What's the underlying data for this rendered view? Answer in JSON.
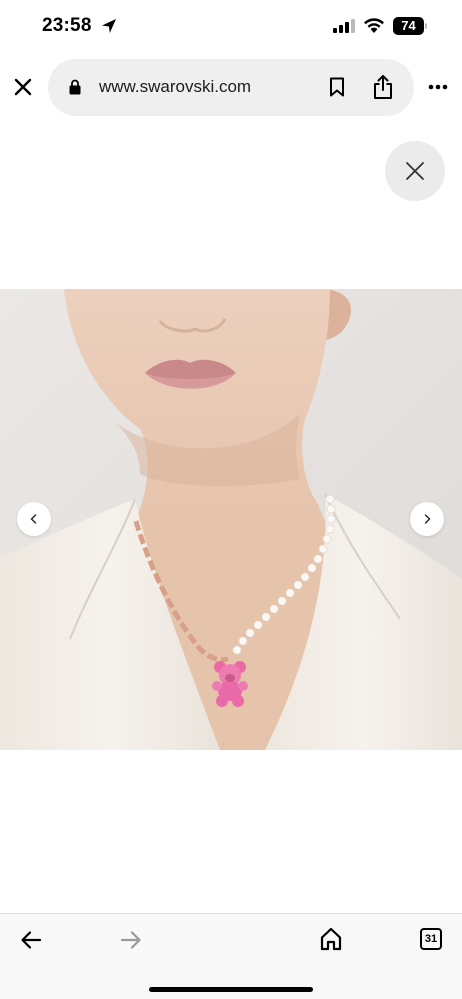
{
  "status_bar": {
    "time": "23:58",
    "battery": "74"
  },
  "browser": {
    "url": "www.swarovski.com"
  },
  "icons": {
    "close_tab": "close-icon",
    "lock": "lock-icon",
    "bookmark": "bookmark-icon",
    "share": "share-icon",
    "more": "more-icon",
    "overlay_close": "close-icon",
    "prev": "chevron-left-icon",
    "next": "chevron-right-icon",
    "back": "arrow-left-icon",
    "forward": "arrow-right-icon",
    "home": "home-icon"
  },
  "bottom_bar": {
    "tab_count": "31"
  },
  "colors": {
    "url_pill": "#efefef",
    "blazer": "#f2ede6",
    "skin": "#e8c6ad",
    "lips": "#c9888a",
    "pendant": "#e86aa6",
    "chain": "#d9a089",
    "forward_disabled": "#9a9a9a"
  }
}
